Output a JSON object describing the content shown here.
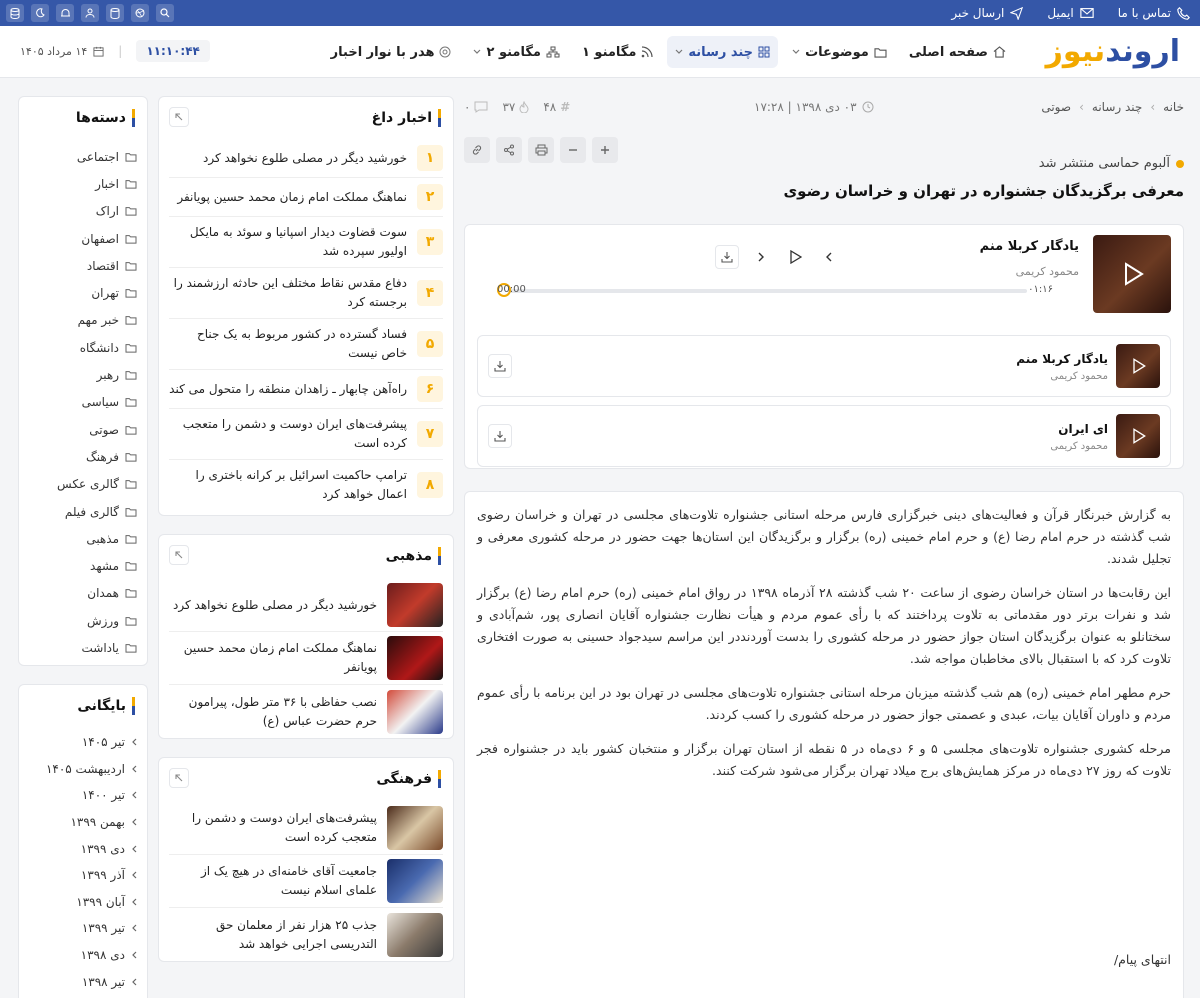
{
  "topbar": {
    "contact": "تماس با ما",
    "email": "ایمیل",
    "send_news": "ارسال خبر",
    "icons": [
      "search-icon",
      "dribbble-icon",
      "database-icon",
      "user-icon",
      "hat-icon",
      "moon-icon",
      "settings-icon"
    ]
  },
  "header": {
    "logo_part1": "اروند",
    "logo_part2": "نیوز",
    "nav": {
      "home": "صفحه اصلی",
      "topics": "موضوعات",
      "multimedia": "چند رسانه",
      "magmenu1": "مگامنو ۱",
      "magmenu2": "مگامنو ۲",
      "header_ticker": "هدر با نوار اخبار"
    },
    "clock": "۱۱:۱۰:۴۴",
    "date": "۱۴ مرداد ۱۴۰۵"
  },
  "sidebar": {
    "categories_title": "دسته‌ها",
    "categories": [
      "اجتماعی",
      "اخبار",
      "اراک",
      "اصفهان",
      "اقتصاد",
      "تهران",
      "خبر مهم",
      "دانشگاه",
      "رهبر",
      "سیاسی",
      "صوتی",
      "فرهنگ",
      "گالری عکس",
      "گالری فیلم",
      "مذهبی",
      "مشهد",
      "همدان",
      "ورزش",
      "یاداشت"
    ],
    "archive_title": "بایگانی",
    "archive": [
      "تیر ۱۴۰۵",
      "اردیبهشت ۱۴۰۵",
      "تیر ۱۴۰۰",
      "بهمن ۱۳۹۹",
      "دی ۱۳۹۹",
      "آذر ۱۳۹۹",
      "آبان ۱۳۹۹",
      "تیر ۱۳۹۹",
      "دی ۱۳۹۸",
      "تیر ۱۳۹۸"
    ]
  },
  "hot_news": {
    "title": "اخبار داغ",
    "items": [
      {
        "num": "۱",
        "text": "خورشید دیگر در مصلی طلوع نخواهد کرد"
      },
      {
        "num": "۲",
        "text": "نماهنگ مملکت امام زمان محمد حسین پویانفر"
      },
      {
        "num": "۳",
        "text": "سوت قضاوت دیدار اسپانیا و سوئد به مایکل اولیور سپرده شد"
      },
      {
        "num": "۴",
        "text": "دفاع مقدس نقاط مختلف این حادثه ارزشمند را برجسته کرد"
      },
      {
        "num": "۵",
        "text": "فساد گسترده در کشور مربوط به یک جناح خاص نیست"
      },
      {
        "num": "۶",
        "text": "راه‌آهن چابهار ـ زاهدان منطقه را متحول می کند"
      },
      {
        "num": "۷",
        "text": "پیشرفت‌های ایران دوست و دشمن را متعجب کرده است"
      },
      {
        "num": "۸",
        "text": "ترامپ حاکمیت اسرائیل بر کرانه باختری را اعمال خواهد کرد"
      }
    ]
  },
  "religious": {
    "title": "مذهبی",
    "items": [
      {
        "text": "خورشید دیگر در مصلی طلوع نخواهد کرد"
      },
      {
        "text": "نماهنگ مملکت امام زمان محمد حسین پویانفر"
      },
      {
        "text": "نصب حفاظی با ۳۶ متر طول، پیرامون حرم حضرت عباس (ع)"
      }
    ]
  },
  "cultural": {
    "title": "فرهنگی",
    "items": [
      {
        "text": "پیشرفت‌های ایران دوست و دشمن را متعجب کرده است"
      },
      {
        "text": "جامعیت آقای خامنه‌ای در هیچ یک از علمای اسلام نیست"
      },
      {
        "text": "جذب ۲۵ هزار نفر از معلمان حق التدریسی اجرایی خواهد شد"
      }
    ]
  },
  "article": {
    "breadcrumb": [
      "خانه",
      "چند رسانه",
      "صوتی"
    ],
    "date": "۰۳ دی ۱۳۹۸ | ۱۷:۲۸",
    "id": "۴۸",
    "views": "۳۷",
    "comments": "۰",
    "lead": "آلبوم حماسی منتشر شد",
    "headline": "معرفی برگزیدگان جشنواره در تهران و خراسان رضوی",
    "player": {
      "title": "یادگار کربلا منم",
      "artist": "محمود کریمی",
      "current": "۰۱:۱۶",
      "total": "00:00",
      "progress": 0.0
    },
    "tracks": [
      {
        "title": "یادگار کربلا منم",
        "artist": "محمود کریمی"
      },
      {
        "title": "ای ایران",
        "artist": "محمود کریمی"
      }
    ],
    "paragraphs": [
      "به گزارش خبرنگار قرآن و فعالیت‌های دینی خبرگزاری فارس مرحله استانی جشنواره تلاوت‌های مجلسی در تهران و خراسان رضوی شب گذشته در حرم امام رضا (ع) و حرم امام خمینی (ره) برگزار و برگزیدگان این استان‌ها جهت حضور در مرحله کشوری معرفی و تجلیل شدند.",
      "این رقابت‌ها در استان خراسان رضوی از ساعت ۲۰ شب گذشته ۲۸ آذرماه ۱۳۹۸ در رواق امام خمینی (ره) حرم امام رضا (ع) برگزار شد و نفرات برتر دور مقدماتی به تلاوت پرداختند که با رأی عموم مردم و هیأت نظارت جشنواره آقایان انصاری پور، شم‌آبادی و سختانلو به عنوان برگزیدگان استان جواز حضور در مرحله کشوری را بدست آوردنددر این مراسم سیدجواد حسینی به صورت افتخاری تلاوت کرد که با استقبال بالای مخاطبان مواجه شد.",
      "حرم مطهر امام خمینی (ره) هم شب گذشته میزبان مرحله استانی جشنواره تلاوت‌های مجلسی در تهران بود در این برنامه با رأی عموم مردم و داوران آقایان بیات، عبدی و عصمتی جواز حضور در مرحله کشوری را کسب کردند.",
      "مرحله کشوری جشنواره تلاوت‌های مجلسی ۵ و ۶ دی‌ماه در ۵ نقطه از استان تهران برگزار و منتخبان کشور باید در جشنواره فجر تلاوت که روز ۲۷ دی‌ماه در مرکز همایش‌های برج میلاد تهران برگزار می‌شود شرکت کنند."
    ],
    "end_note": "انتهای پیام/"
  },
  "colors": {
    "brand_blue": "#2d4fa3",
    "accent": "#f2a900",
    "topbar": "#3557a8"
  }
}
